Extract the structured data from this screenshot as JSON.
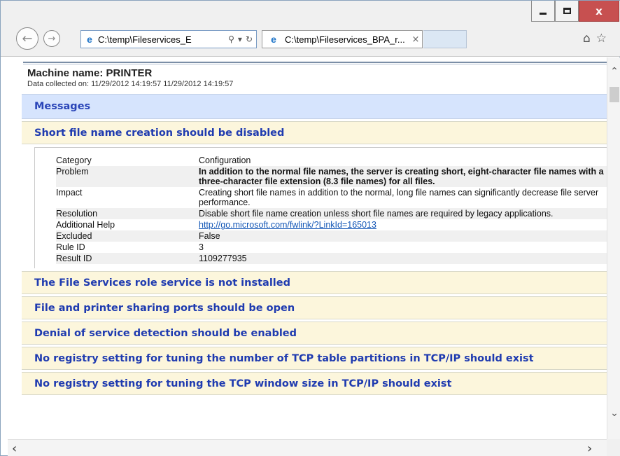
{
  "window": {
    "minimize_icon": "minimize-icon",
    "maximize_icon": "maximize-icon",
    "close_icon": "close-icon"
  },
  "nav": {
    "address": "C:\\temp\\Fileservices_E",
    "tab_title": "C:\\temp\\Fileservices_BPA_r...",
    "tab_close": "×"
  },
  "report": {
    "machine_name": "Machine name: PRINTER",
    "data_collected": "Data collected on: 11/29/2012 14:19:57 11/29/2012 14:19:57",
    "messages_header": "Messages",
    "expanded_title": "Short file name creation should be disabled",
    "details": [
      {
        "label": "Category",
        "value": "Configuration",
        "style": ""
      },
      {
        "label": "Problem",
        "value": "In addition to the normal file names, the server is creating short, eight-character file names with a three-character file extension (8.3 file names) for all files.",
        "style": "bold"
      },
      {
        "label": "Impact",
        "value": "Creating short file names in addition to the normal, long file names can significantly decrease file server performance.",
        "style": ""
      },
      {
        "label": "Resolution",
        "value": "Disable short file name creation unless short file names are required by legacy applications.",
        "style": ""
      },
      {
        "label": "Additional Help",
        "value": "http://go.microsoft.com/fwlink/?LinkId=165013",
        "style": "link"
      },
      {
        "label": "Excluded",
        "value": "False",
        "style": ""
      },
      {
        "label": "Rule ID",
        "value": "3",
        "style": ""
      },
      {
        "label": "Result ID",
        "value": "1109277935",
        "style": ""
      }
    ],
    "items": [
      "The File Services role service is not installed",
      "File and printer sharing ports should be open",
      "Denial of service detection should be enabled",
      "No registry setting for tuning the number of TCP table partitions in TCP/IP should exist",
      "No registry setting for tuning the TCP window size in TCP/IP should exist"
    ]
  },
  "colors": {
    "messages_bar": "#d6e4fd",
    "item_bar": "#fcf6dc",
    "heading_text": "#1f3bb0",
    "link": "#1256b6"
  }
}
